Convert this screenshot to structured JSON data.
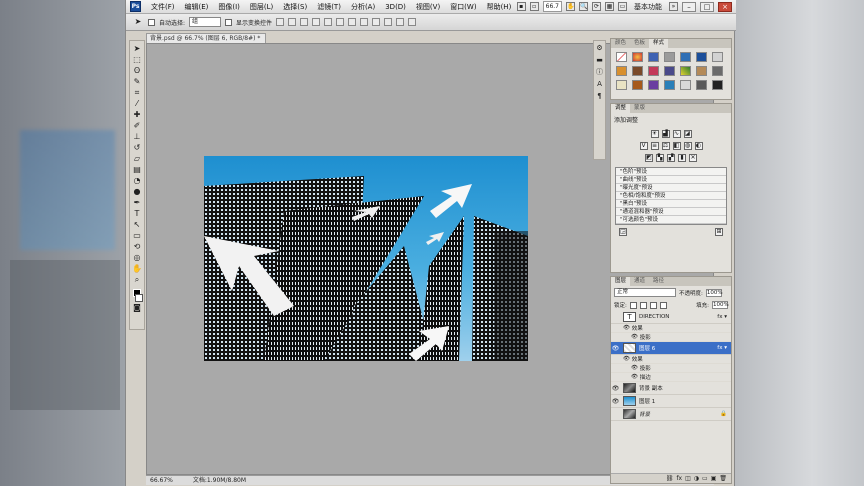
{
  "app": {
    "logo": "Ps",
    "menu": [
      "文件(F)",
      "编辑(E)",
      "图像(I)",
      "图层(L)",
      "选择(S)",
      "滤镜(T)",
      "分析(A)",
      "3D(D)",
      "视图(V)",
      "窗口(W)",
      "帮助(H)"
    ],
    "zoom": "66.7",
    "workspace": "基本功能"
  },
  "options": {
    "auto_select_label": "自动选择:",
    "auto_select_value": "组",
    "show_transform_label": "显示变换控件"
  },
  "document": {
    "tab_title": "背景.psd @ 66.7% (图层 6, RGB/8#) *",
    "status_zoom": "66.67%",
    "status_doc": "文档:1.90M/8.80M"
  },
  "panels": {
    "styles_tabs": [
      "颜色",
      "色板",
      "样式"
    ],
    "adjust_tabs": [
      "调整",
      "蒙版"
    ],
    "adjust_title": "添加调整",
    "presets": [
      "\"色阶\"预设",
      "\"曲线\"预设",
      "\"曝光度\"预设",
      "\"色相/饱和度\"预设",
      "\"黑白\"预设",
      "\"通道混和器\"预设",
      "\"可选颜色\"预设"
    ],
    "layers_tabs": [
      "图层",
      "通道",
      "路径"
    ],
    "blend_mode": "正常",
    "opacity_label": "不透明度:",
    "opacity_value": "100%",
    "lock_label": "锁定:",
    "fill_label": "填充:",
    "fill_value": "100%"
  },
  "layers": [
    {
      "name": "DIRECTION",
      "type": "text"
    },
    {
      "name": "效果",
      "type": "effects"
    },
    {
      "name": "投影",
      "type": "effect"
    },
    {
      "name": "图层 6",
      "type": "layer",
      "selected": true
    },
    {
      "name": "效果",
      "type": "effects"
    },
    {
      "name": "投影",
      "type": "effect"
    },
    {
      "name": "描边",
      "type": "effect"
    },
    {
      "name": "背景 副本",
      "type": "layer"
    },
    {
      "name": "图层 1",
      "type": "layer"
    },
    {
      "name": "背景",
      "type": "background"
    }
  ],
  "colors": {
    "sky_top": "#1e8fd0",
    "sky_bottom": "#8cc7e8",
    "selected_layer": "#3b6fc7"
  }
}
